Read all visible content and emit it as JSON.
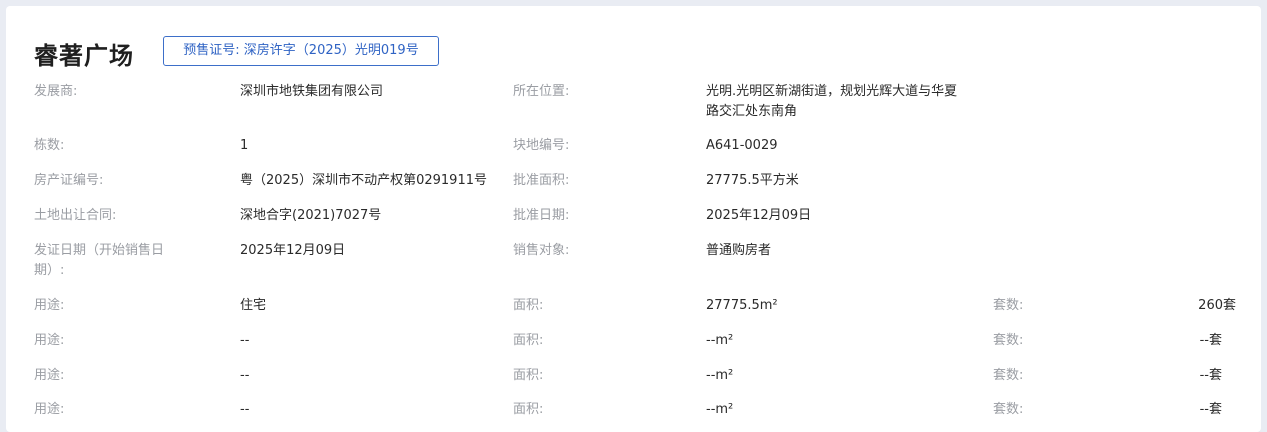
{
  "project": {
    "name": "睿著广场",
    "presale_permit": "预售证号: 深房许字（2025）光明019号"
  },
  "details": {
    "developer_label": "发展商:",
    "developer": "深圳市地铁集团有限公司",
    "location_label": "所在位置:",
    "location_line1": "光明.光明区新湖街道，规划光辉大道与华夏",
    "location_line2": "路交汇处东南角",
    "buildings_label": "栋数:",
    "buildings": "1",
    "plot_label": "块地编号:",
    "plot": "A641-0029",
    "property_cert_label": "房产证编号:",
    "property_cert": "粤（2025）深圳市不动产权第0291911号",
    "approved_area_label": "批准面积:",
    "approved_area": "27775.5平方米",
    "land_contract_label": "土地出让合同:",
    "land_contract": "深地合字(2021)7027号",
    "approval_date_label": "批准日期:",
    "approval_date": "2025年12月09日",
    "issue_date_label_line1": "发证日期（开始销售日",
    "issue_date_label_line2": "期）:",
    "issue_date": "2025年12月09日",
    "sales_target_label": "销售对象:",
    "sales_target": "普通购房者"
  },
  "usage_labels": {
    "use": "用途:",
    "area": "面积:",
    "units": "套数:"
  },
  "usage_rows": [
    {
      "use": "住宅",
      "area": "27775.5m²",
      "units": "260套"
    },
    {
      "use": "--",
      "area": "--m²",
      "units": "--套"
    },
    {
      "use": "--",
      "area": "--m²",
      "units": "--套"
    },
    {
      "use": "--",
      "area": "--m²",
      "units": "--套"
    }
  ]
}
